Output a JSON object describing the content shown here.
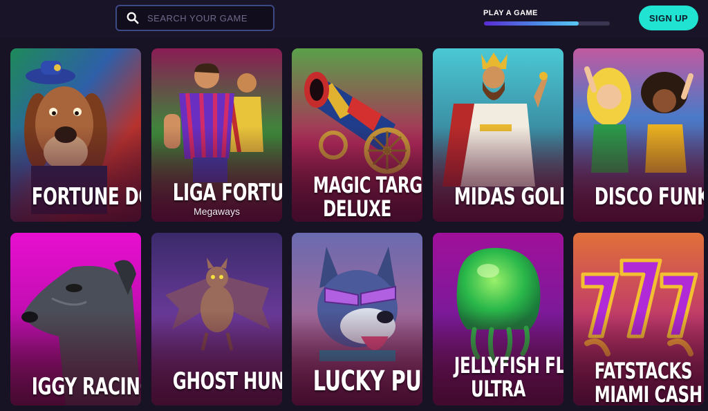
{
  "search": {
    "placeholder": "SEARCH YOUR GAME"
  },
  "progress": {
    "label": "PLAY A GAME",
    "fraction": 0.75
  },
  "signup": {
    "label": "SIGN UP"
  },
  "colors": {
    "accent": "#20e3d2",
    "background": "#171224",
    "progress_start": "#5a2bd6",
    "progress_end": "#58c8f2"
  },
  "games": [
    {
      "id": "fortune-dogs",
      "title": [
        "FORTUNE DOGS"
      ],
      "subtitle": ""
    },
    {
      "id": "liga-fortuna",
      "title": [
        "LIGA FORTUNA"
      ],
      "subtitle": "Megaways"
    },
    {
      "id": "magic-target-deluxe",
      "title": [
        "MAGIC TARGET",
        "DELUXE"
      ],
      "subtitle": ""
    },
    {
      "id": "midas-gold",
      "title": [
        "MIDAS GOLD"
      ],
      "subtitle": ""
    },
    {
      "id": "disco-funk",
      "title": [
        "DISCO FUNK"
      ],
      "subtitle": ""
    },
    {
      "id": "iggy-racing",
      "title": [
        "IGGY RACING"
      ],
      "subtitle": ""
    },
    {
      "id": "ghost-hunter",
      "title": [
        "GHOST HUNTER"
      ],
      "subtitle": ""
    },
    {
      "id": "lucky-pups",
      "title": [
        "LUCKY PUPS"
      ],
      "subtitle": ""
    },
    {
      "id": "jellyfish-flow-ultra",
      "title": [
        "JELLYFISH FLOW",
        "ULTRA"
      ],
      "subtitle": ""
    },
    {
      "id": "fatstacks-miami-cash",
      "title": [
        "FATSTACKS",
        "MIAMI CASH"
      ],
      "subtitle": ""
    }
  ]
}
